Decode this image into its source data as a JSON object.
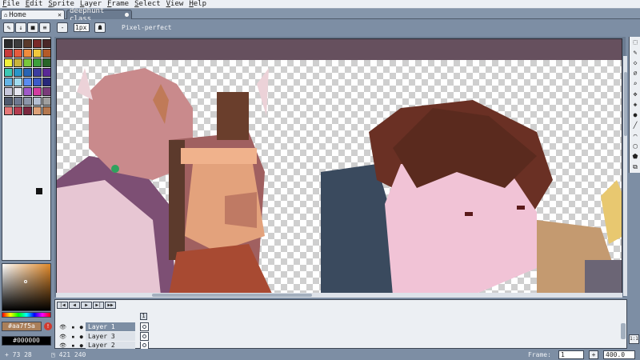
{
  "menu": [
    "File",
    "Edit",
    "Sprite",
    "Layer",
    "Frame",
    "Select",
    "View",
    "Help"
  ],
  "tabs": {
    "home_label": "Home",
    "document_label": "deephunt class"
  },
  "toolbar": {
    "brush_size": "1px",
    "pixel_perfect_label": "Pixel-perfect"
  },
  "palette": {
    "swatches": [
      "#2b2b2b",
      "#3c3c3c",
      "#5a3a2a",
      "#7a2a2a",
      "#4a2828",
      "#c83c3c",
      "#e65a3c",
      "#f08c3c",
      "#f0c83c",
      "#b45a28",
      "#f0f03c",
      "#c8b43c",
      "#78c83c",
      "#3ca03c",
      "#286428",
      "#3cc8b4",
      "#2896c8",
      "#2864b4",
      "#3c3ca0",
      "#5a2896",
      "#64b4e6",
      "#a0dcf0",
      "#5a8cf0",
      "#3c5ac8",
      "#28287a",
      "#c8c8dc",
      "#e6e6f0",
      "#a05ac8",
      "#d23ca0",
      "#7a3c7a",
      "#505a6e",
      "#6e7890",
      "#8c96aa",
      "#b4bed2",
      "#a0a0a0",
      "#e67878",
      "#b43c50",
      "#7a2840",
      "#dca078",
      "#b47850"
    ]
  },
  "colors": {
    "foreground": "#aa7f5a",
    "background": "#000000"
  },
  "timeline": {
    "frame_number": "1",
    "layers": [
      "Layer 1",
      "Layer 3",
      "Layer 2"
    ]
  },
  "status": {
    "cursor": "73 28",
    "sprite_size": "421 240",
    "frame_label": "Frame:",
    "frame_value": "1",
    "add_frame": "+",
    "zoom": "400.0"
  }
}
